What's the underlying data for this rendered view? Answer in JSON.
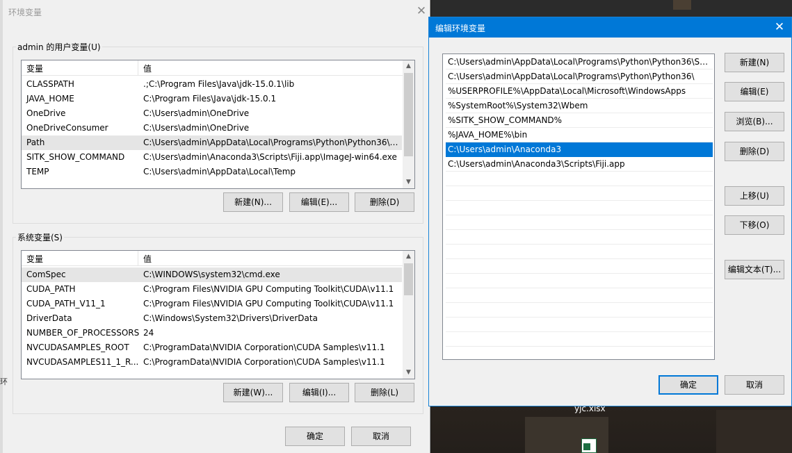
{
  "env_dialog": {
    "title": "环境变量",
    "close_glyph": "✕",
    "user_group": {
      "label": "admin 的用户变量(U)",
      "headers": [
        "变量",
        "值"
      ],
      "rows": [
        {
          "name": "CLASSPATH",
          "value": ".;C:\\Program Files\\Java\\jdk-15.0.1\\lib"
        },
        {
          "name": "JAVA_HOME",
          "value": "C:\\Program Files\\Java\\jdk-15.0.1"
        },
        {
          "name": "OneDrive",
          "value": "C:\\Users\\admin\\OneDrive"
        },
        {
          "name": "OneDriveConsumer",
          "value": "C:\\Users\\admin\\OneDrive"
        },
        {
          "name": "Path",
          "value": "C:\\Users\\admin\\AppData\\Local\\Programs\\Python\\Python36\\S..."
        },
        {
          "name": "SITK_SHOW_COMMAND",
          "value": "C:\\Users\\admin\\Anaconda3\\Scripts\\Fiji.app\\ImageJ-win64.exe"
        },
        {
          "name": "TEMP",
          "value": "C:\\Users\\admin\\AppData\\Local\\Temp"
        }
      ],
      "buttons": {
        "new": "新建(N)...",
        "edit": "编辑(E)...",
        "delete": "删除(D)"
      }
    },
    "system_group": {
      "label": "系统变量(S)",
      "headers": [
        "变量",
        "值"
      ],
      "rows": [
        {
          "name": "ComSpec",
          "value": "C:\\WINDOWS\\system32\\cmd.exe"
        },
        {
          "name": "CUDA_PATH",
          "value": "C:\\Program Files\\NVIDIA GPU Computing Toolkit\\CUDA\\v11.1"
        },
        {
          "name": "CUDA_PATH_V11_1",
          "value": "C:\\Program Files\\NVIDIA GPU Computing Toolkit\\CUDA\\v11.1"
        },
        {
          "name": "DriverData",
          "value": "C:\\Windows\\System32\\Drivers\\DriverData"
        },
        {
          "name": "NUMBER_OF_PROCESSORS",
          "value": "24"
        },
        {
          "name": "NVCUDASAMPLES_ROOT",
          "value": "C:\\ProgramData\\NVIDIA Corporation\\CUDA Samples\\v11.1"
        },
        {
          "name": "NVCUDASAMPLES11_1_R...",
          "value": "C:\\ProgramData\\NVIDIA Corporation\\CUDA Samples\\v11.1"
        }
      ],
      "buttons": {
        "new": "新建(W)...",
        "edit": "编辑(I)...",
        "delete": "删除(L)"
      }
    },
    "ok": "确定",
    "cancel": "取消"
  },
  "edit_dialog": {
    "title": "编辑环境变量",
    "close_glyph": "✕",
    "paths": [
      "C:\\Users\\admin\\AppData\\Local\\Programs\\Python\\Python36\\Scri...",
      "C:\\Users\\admin\\AppData\\Local\\Programs\\Python\\Python36\\",
      "%USERPROFILE%\\AppData\\Local\\Microsoft\\WindowsApps",
      "%SystemRoot%\\System32\\Wbem",
      "%SITK_SHOW_COMMAND%",
      "%JAVA_HOME%\\bin",
      "C:\\Users\\admin\\Anaconda3",
      "C:\\Users\\admin\\Anaconda3\\Scripts\\Fiji.app"
    ],
    "selected_index": 6,
    "buttons": {
      "new": "新建(N)",
      "edit": "编辑(E)",
      "browse": "浏览(B)...",
      "delete": "删除(D)",
      "move_up": "上移(U)",
      "move_down": "下移(O)",
      "edit_text": "编辑文本(T)...",
      "ok": "确定",
      "cancel": "取消"
    }
  },
  "desktop": {
    "file_label": "yjc.xlsx",
    "edge_glyph": "环"
  },
  "colors": {
    "accent": "#0078d7",
    "dialog_bg": "#f0f0f0",
    "selected_row": "#e5e5e5"
  }
}
